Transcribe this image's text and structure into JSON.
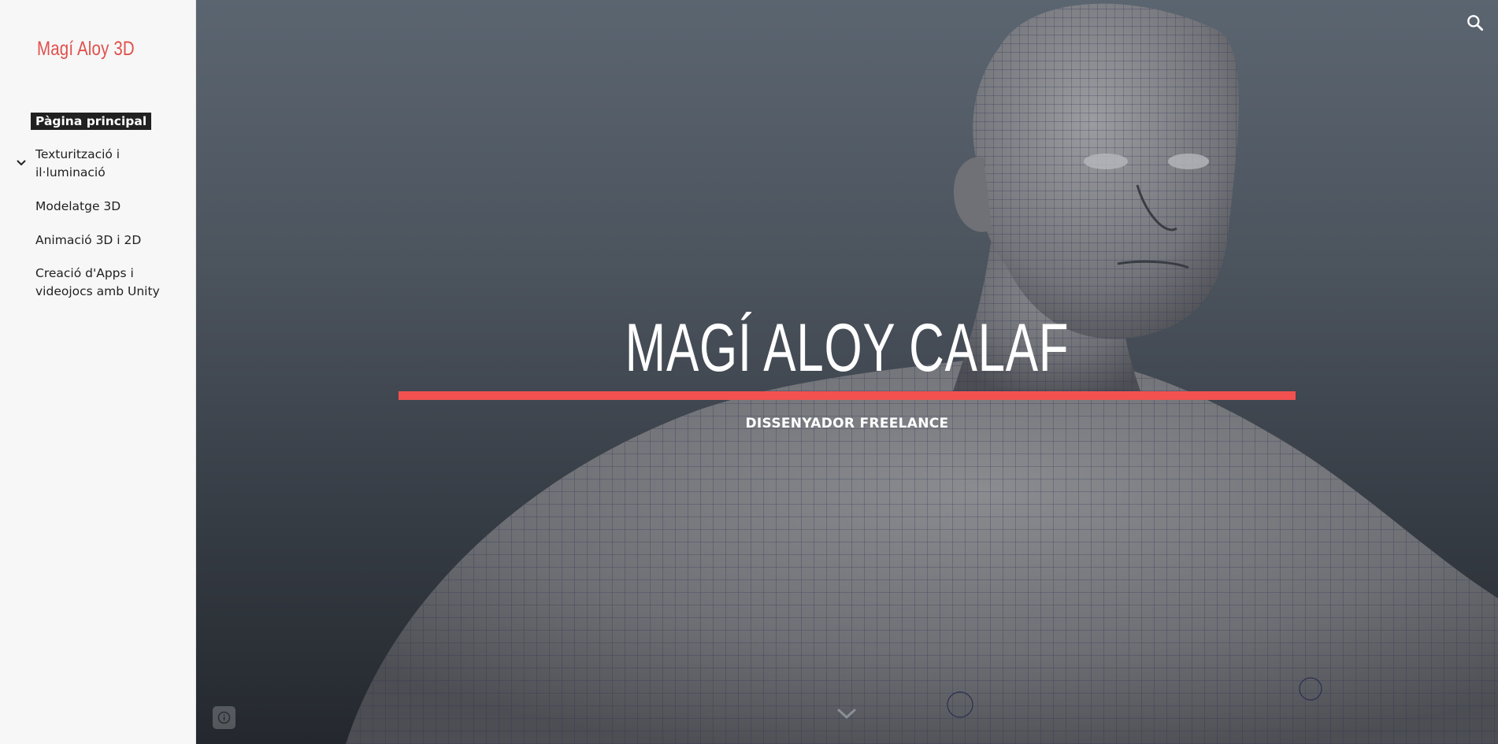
{
  "sidebar": {
    "site_title": "Magí Aloy 3D",
    "nav_items": [
      {
        "label": "Pàgina principal",
        "active": true
      },
      {
        "label": "Texturització i il·luminació",
        "has_children": true,
        "expand_icon": "chevron-down-icon"
      },
      {
        "label": "Modelatge 3D"
      },
      {
        "label": "Animació 3D i 2D"
      },
      {
        "label": "Creació d'Apps i videojocs amb Unity"
      }
    ]
  },
  "hero": {
    "title": "MAGÍ ALOY CALAF",
    "subtitle": "DISSENYADOR FREELANCE",
    "accent_color": "#f25150",
    "background_image": "3D wireframe human model",
    "scroll_icon": "chevron-down-icon",
    "info_icon": "info-icon",
    "search_icon": "search-icon"
  },
  "colors": {
    "brand": "#e0504c",
    "accent": "#f25150",
    "sidebar_bg": "#f7f7f7",
    "active_nav_bg": "#212121"
  }
}
